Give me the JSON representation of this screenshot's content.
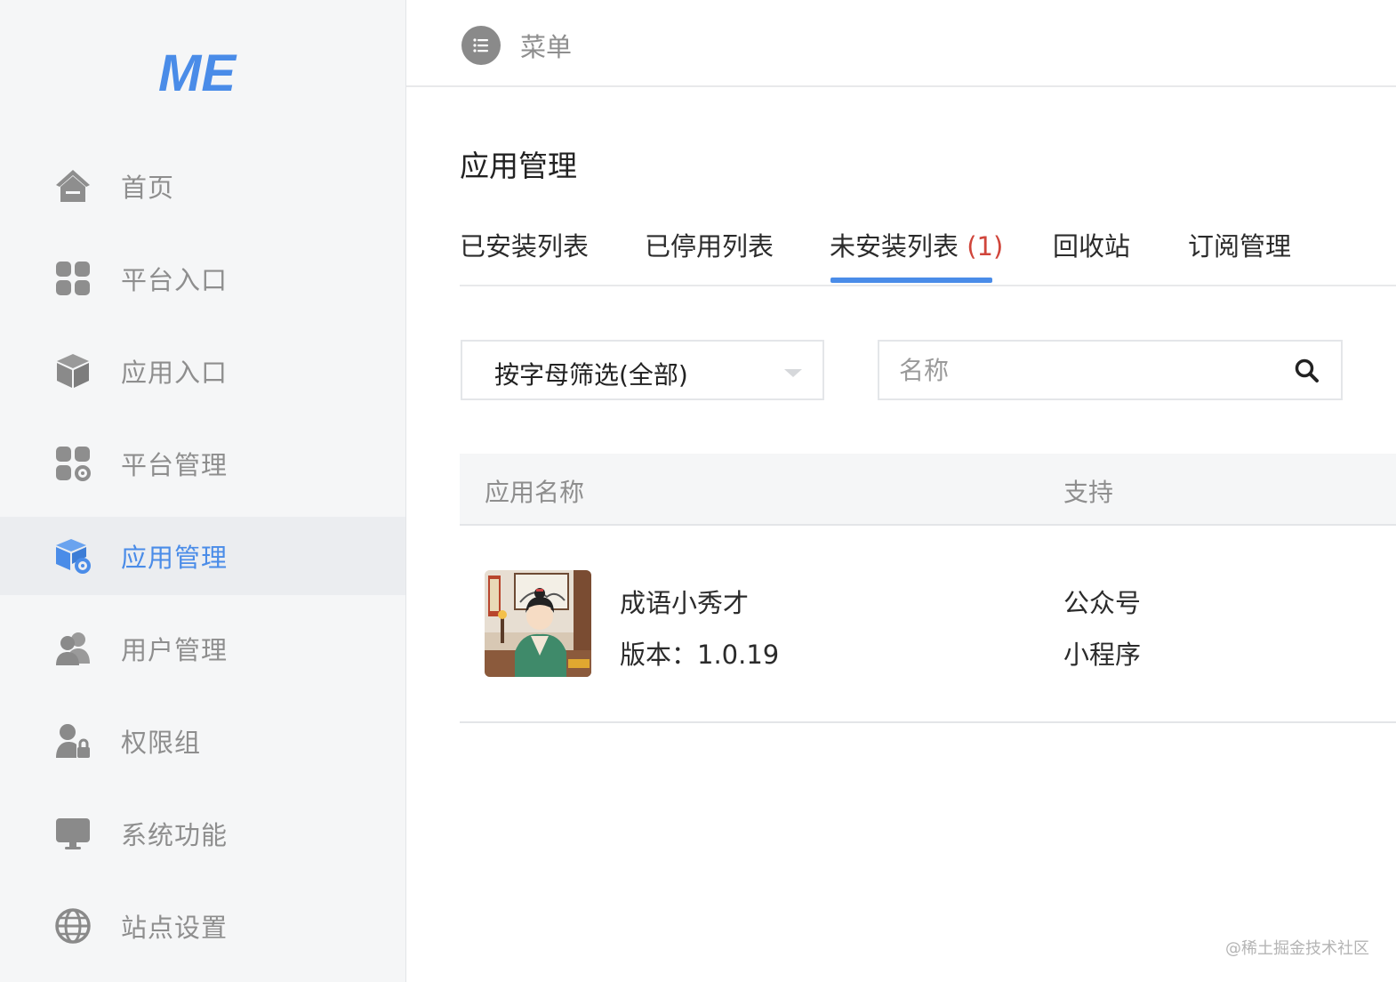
{
  "logo": {
    "text": "ME",
    "color": "#4a8ce8"
  },
  "sidebar": {
    "items": [
      {
        "label": "首页",
        "icon": "home-icon",
        "active": false
      },
      {
        "label": "平台入口",
        "icon": "grid-icon",
        "active": false
      },
      {
        "label": "应用入口",
        "icon": "cube-icon",
        "active": false
      },
      {
        "label": "平台管理",
        "icon": "grid-gear-icon",
        "active": false
      },
      {
        "label": "应用管理",
        "icon": "cube-gear-icon",
        "active": true
      },
      {
        "label": "用户管理",
        "icon": "users-icon",
        "active": false
      },
      {
        "label": "权限组",
        "icon": "user-lock-icon",
        "active": false
      },
      {
        "label": "系统功能",
        "icon": "monitor-icon",
        "active": false
      },
      {
        "label": "站点设置",
        "icon": "globe-icon",
        "active": false
      }
    ]
  },
  "topbar": {
    "menu_label": "菜单",
    "menu_icon": "list-icon"
  },
  "main": {
    "title": "应用管理",
    "tabs": [
      {
        "label": "已安装列表",
        "count": ""
      },
      {
        "label": "已停用列表",
        "count": ""
      },
      {
        "label": "未安装列表",
        "count": "(1)"
      },
      {
        "label": "回收站",
        "count": ""
      },
      {
        "label": "订阅管理",
        "count": ""
      }
    ],
    "active_tab": 2,
    "filter": {
      "value": "按字母筛选(全部)"
    },
    "search": {
      "placeholder": "名称",
      "value": ""
    },
    "table": {
      "columns": [
        "应用名称",
        "支持"
      ],
      "rows": [
        {
          "name": "成语小秀才",
          "version": "版本：1.0.19",
          "supports": [
            "公众号",
            "小程序"
          ]
        }
      ]
    }
  },
  "watermark": "@稀土掘金技术社区",
  "colors": {
    "accent": "#4a8ce8",
    "count_red": "#d0453b",
    "sidebar_bg": "#f5f6f7"
  }
}
